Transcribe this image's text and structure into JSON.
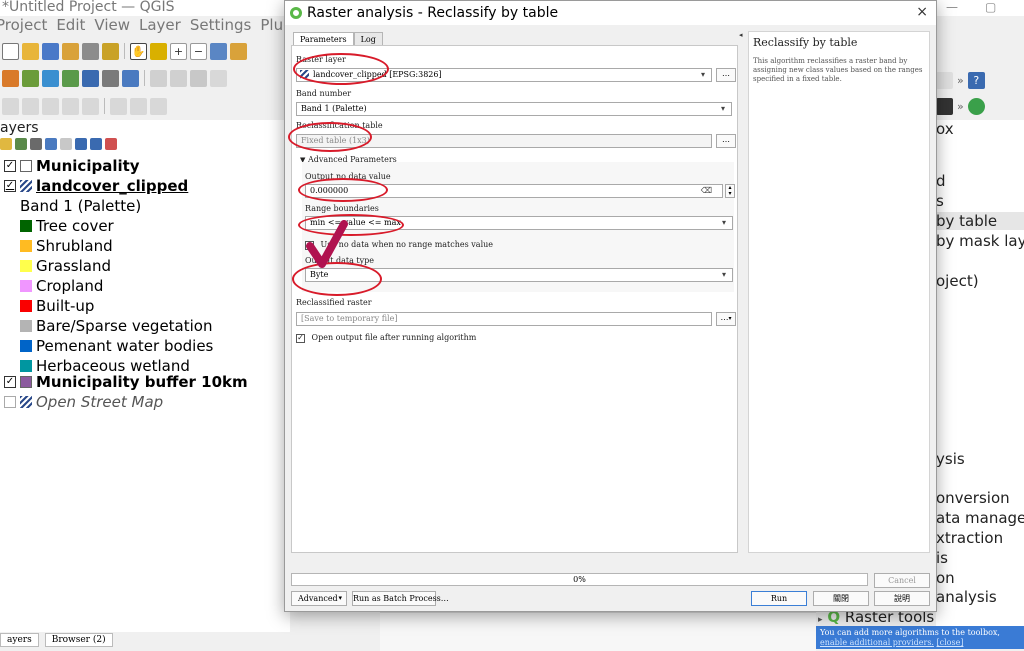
{
  "qgis": {
    "window_title": "*Untitled Project — QGIS",
    "menu": [
      "Project",
      "Edit",
      "View",
      "Layer",
      "Settings",
      "Plugin"
    ],
    "layers_panel": {
      "header": "ayers",
      "layers": [
        {
          "name": "Municipality",
          "checked": true,
          "style": "bold"
        },
        {
          "name": "landcover_clipped",
          "checked": true,
          "style": "bold-underline"
        },
        {
          "name": "Municipality buffer 10km",
          "checked": true,
          "style": "bold"
        },
        {
          "name": "Open Street Map",
          "checked": false,
          "style": "italic"
        }
      ],
      "band_label": "Band 1 (Palette)",
      "legend": [
        {
          "label": "Tree cover",
          "color": "#006400"
        },
        {
          "label": "Shrubland",
          "color": "#ffbb22"
        },
        {
          "label": "Grassland",
          "color": "#ffff4c"
        },
        {
          "label": "Cropland",
          "color": "#f096ff"
        },
        {
          "label": "Built-up",
          "color": "#fa0000"
        },
        {
          "label": "Bare/Sparse vegetation",
          "color": "#b4b4b4"
        },
        {
          "label": "Pemenant water bodies",
          "color": "#0064c8"
        },
        {
          "label": "Herbaceous wetland",
          "color": "#0096a0"
        }
      ],
      "municipality_buffer_color": "#8b5a9e"
    },
    "bottom_tabs": [
      "ayers",
      "Browser (2)"
    ],
    "toolbox": {
      "header": "ox",
      "items": [
        "d",
        "s",
        "by table",
        "by mask layer",
        "oject)",
        "ysis",
        "onversion",
        "ata manage...",
        "xtraction",
        "is",
        "on",
        "analysis"
      ],
      "raster_tools": "Raster tools",
      "info": "You can add more algorithms to the toolbox,",
      "info_link": "enable additional providers.",
      "info_close": "[close]"
    },
    "right_toolbar": [
      "»",
      "»"
    ]
  },
  "dialog": {
    "title": "Raster analysis - Reclassify by table",
    "close_symbol": "×",
    "tabs": [
      "Parameters",
      "Log"
    ],
    "raster_layer_label": "Raster layer",
    "raster_layer_value": "landcover_clipped [EPSG:3826]",
    "band_number_label": "Band number",
    "band_number_value": "Band 1 (Palette)",
    "reclass_table_label": "Reclassification table",
    "reclass_table_value": "Fixed table (1x3)",
    "advanced_label": "Advanced Parameters",
    "nodata_label": "Output no data value",
    "nodata_value": "0.000000",
    "range_label": "Range boundaries",
    "range_value": "min <= value <= max",
    "use_nodata_label": "Use no data when no range matches value",
    "output_type_label": "Output data type",
    "output_type_value": "Byte",
    "reclassified_label": "Reclassified raster",
    "reclassified_placeholder": "[Save to temporary file]",
    "open_output_label": "Open output file after running algorithm",
    "dots": "…",
    "help_title": "Reclassify by table",
    "help_text": "This algorithm reclassifies a raster band by assigning new class values based on the ranges specified in a fixed table.",
    "progress_text": "0%",
    "progress_value": 0,
    "buttons": {
      "cancel": "Cancel",
      "advanced": "Advanced",
      "batch": "Run as Batch Process…",
      "run": "Run",
      "close": "關閉",
      "help": "說明"
    }
  },
  "annotation_color": "#d81b2a",
  "checkmark_color": "#b0124f"
}
